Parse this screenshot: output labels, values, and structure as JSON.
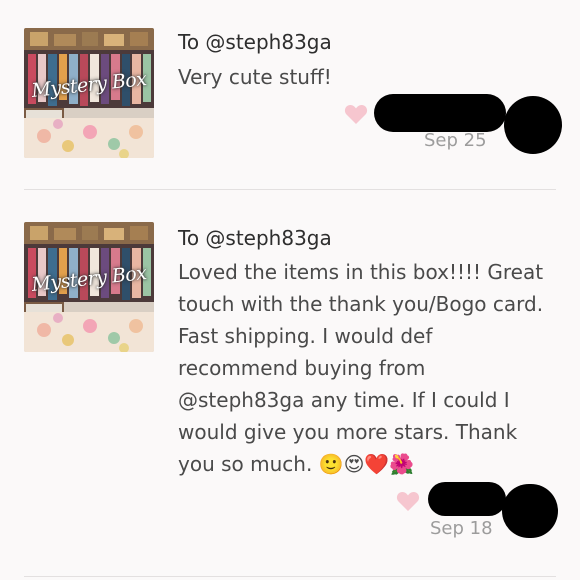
{
  "reviews": [
    {
      "thumbnail_title": "Mystery Box",
      "to": "To @steph83ga",
      "comment": "Very cute stuff!",
      "emojis": "",
      "like_icon": "heart-icon",
      "date": "Sep 25",
      "username_redacted": true
    },
    {
      "thumbnail_title": "Mystery Box",
      "to": "To @steph83ga",
      "comment": "Loved the items in this box!!!! Great touch with the thank you/Bogo card. Fast shipping. I would def recommend buying from @steph83ga any time. If I could I would give you more stars. Thank you so much.",
      "emojis": "🙂😍❤️🌺",
      "like_icon": "heart-icon",
      "date": "Sep 18",
      "username_redacted": true
    }
  ],
  "colors": {
    "background": "#fbf9f9",
    "heart": "#f6c6cf",
    "date": "#9c9c9c",
    "divider": "#e3e0e0"
  }
}
